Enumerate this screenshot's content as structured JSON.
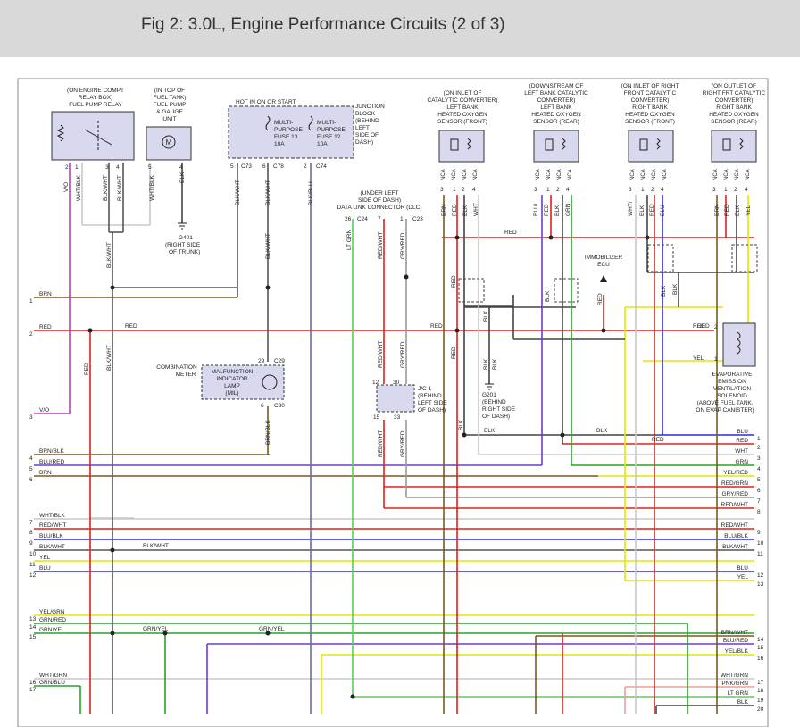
{
  "header": {
    "title": "Fig 2: 3.0L, Engine Performance Circuits (2 of 3)"
  },
  "components": {
    "fuel_pump_relay": {
      "lines": [
        "(ON ENGINE COMPT",
        "RELAY BOX)",
        "FUEL PUMP RELAY"
      ],
      "pins": [
        "2",
        "1",
        "3",
        "4"
      ],
      "wires": [
        "V/O",
        "WHT/BLK",
        "BLK/WHT",
        "BLK/WHT"
      ]
    },
    "fuel_pump": {
      "lines": [
        "(IN TOP OF",
        "FUEL TANK)",
        "FUEL PUMP",
        "& GAUGE",
        "UNIT"
      ],
      "pins": [
        "5",
        "4"
      ],
      "wires": [
        "WHT/BLK",
        "BLK"
      ],
      "motor": "M"
    },
    "ground_g401": {
      "lines": [
        "G401",
        "(RIGHT SIDE",
        "OF TRUNK)"
      ]
    },
    "hot_label": "HOT IN ON OR START",
    "junction_block": {
      "lines": [
        "JUNCTION",
        "BLOCK",
        "(BEHIND",
        "LEFT",
        "SIDE OF",
        "DASH)"
      ]
    },
    "fuse13": {
      "lines": [
        "MULTI-",
        "PURPOSE",
        "FUSE 13",
        "10A"
      ]
    },
    "fuse12": {
      "lines": [
        "MULTI-",
        "PURPOSE",
        "FUSE 12",
        "10A"
      ]
    },
    "fuse_pins": [
      "5",
      "C73",
      "6",
      "C78",
      "2",
      "C74"
    ],
    "fuse_wires": [
      "BLK/WHT",
      "BLK/WHT",
      "BLK/BLU"
    ],
    "dlc": {
      "lines": [
        "(UNDER LEFT",
        "SIDE OF DASH)",
        "DATA LINK CONNECTOR (DLC)"
      ],
      "pins": [
        "26",
        "C24",
        "7",
        "1",
        "C23"
      ],
      "wires": [
        "LT GRN",
        "RED/WHT",
        "GRY/RED"
      ]
    },
    "o2_lf": {
      "lines": [
        "(ON INLET OF",
        "CATALYTIC CONVERTER)",
        "LEFT BANK",
        "HEATED OXYGEN",
        "SENSOR (FRONT)"
      ],
      "pins": [
        "3",
        "1",
        "2",
        "4"
      ],
      "wires": [
        "BRN",
        "RED",
        "BLK",
        "WHT"
      ]
    },
    "o2_lr": {
      "lines": [
        "(DOWNSTREAM OF",
        "LEFT BANK CATALYTIC",
        "CONVERTER)",
        "LEFT BANK",
        "HEATED OXYGEN",
        "SENSOR (REAR)"
      ],
      "pins": [
        "3",
        "1",
        "2",
        "4"
      ],
      "wires": [
        "BLU/",
        "RED",
        "BLK",
        "GRN"
      ]
    },
    "o2_rf": {
      "lines": [
        "(ON INLET OF RIGHT",
        "FRONT CATALYTIC",
        "CONVERTER)",
        "RIGHT BANK",
        "HEATED OXYGEN",
        "SENSOR (FRONT)"
      ],
      "pins": [
        "3",
        "1",
        "2",
        "4"
      ],
      "wires": [
        "WHT/",
        "BLK",
        "RED",
        "BLU"
      ]
    },
    "o2_rr": {
      "lines": [
        "(ON OUTLET OF",
        "RIGHT FRT CATALYTIC",
        "CONVERTER)",
        "RIGHT BANK",
        "HEATED OXYGEN",
        "SENSOR (REAR)"
      ],
      "pins": [
        "3",
        "1",
        "2",
        "4"
      ],
      "wires": [
        "BRN",
        "RED",
        "BLK",
        "YEL"
      ]
    },
    "nca": "NCA",
    "immobilizer": {
      "lines": [
        "IMMOBILIZER",
        "ECU"
      ],
      "wire": "RED"
    },
    "mil": {
      "left_lines": [
        "COMBINATION",
        "METER"
      ],
      "lines": [
        "MALFUNCTION",
        "INDICATOR",
        "LAMP",
        "(MIL)"
      ],
      "pins": [
        "29",
        "C29",
        "6",
        "C30"
      ],
      "wire": "BRN/BLK"
    },
    "jc1": {
      "lines": [
        "J/C 1",
        "(BEHIND",
        "LEFT SIDE",
        "OF DASH)"
      ],
      "pins": [
        "12",
        "30",
        "15",
        "33"
      ],
      "wires": [
        "RED/WHT",
        "GRY/RED",
        "RED/WHT",
        "GRY/RED"
      ]
    },
    "g201": {
      "lines": [
        "G201",
        "(BEHIND",
        "RIGHT SIDE",
        "OF DASH)"
      ],
      "wire": "BLK"
    },
    "evap": {
      "lines": [
        "EVAPORATIVE",
        "EMISSION",
        "VENTILATION",
        "SOLENOID",
        "(ABOVE FUEL TANK,",
        "ON EVAP CANISTER)"
      ],
      "pins": [
        "2",
        "1"
      ],
      "wires": [
        "RED",
        "YEL"
      ]
    }
  },
  "left_wires": [
    {
      "num": "1",
      "label": "BRN"
    },
    {
      "num": "2",
      "label": "RED"
    },
    {
      "num": "3",
      "label": "V/O"
    },
    {
      "num": "4",
      "label": "BRN/BLK"
    },
    {
      "num": "5",
      "label": "BLU/RED"
    },
    {
      "num": "6",
      "label": "BRN"
    },
    {
      "num": "7",
      "label": "WHT/BLK"
    },
    {
      "num": "8",
      "label": "RED/WHT"
    },
    {
      "num": "9",
      "label": "BLU/BLK"
    },
    {
      "num": "10",
      "label": "BLK/WHT"
    },
    {
      "num": "11",
      "label": "YEL"
    },
    {
      "num": "12",
      "label": "BLU"
    },
    {
      "num": "13",
      "label": "YEL/GRN"
    },
    {
      "num": "14",
      "label": "GRN/RED"
    },
    {
      "num": "15",
      "label": "GRN/YEL"
    },
    {
      "num": "16",
      "label": "WHT/GRN"
    },
    {
      "num": "17",
      "label": "GRN/BLU"
    }
  ],
  "right_wires": [
    {
      "num": "1",
      "label": "BLU"
    },
    {
      "num": "2",
      "label": "RED"
    },
    {
      "num": "3",
      "label": "WHT"
    },
    {
      "num": "4",
      "label": "GRN"
    },
    {
      "num": "5",
      "label": "YEL/RED"
    },
    {
      "num": "6",
      "label": "RED/GRN"
    },
    {
      "num": "7",
      "label": "GRY/RED"
    },
    {
      "num": "8",
      "label": "RED/WHT"
    },
    {
      "num": "9",
      "label": "RED/WHT"
    },
    {
      "num": "10",
      "label": "BLU/BLK"
    },
    {
      "num": "11",
      "label": "BLK/WHT"
    },
    {
      "num": "12",
      "label": "BLU"
    },
    {
      "num": "13",
      "label": "YEL"
    },
    {
      "num": "14",
      "label": "BRN/WHT"
    },
    {
      "num": "15",
      "label": "BLU/RED"
    },
    {
      "num": "16",
      "label": "YEL/BLK"
    },
    {
      "num": "17",
      "label": "WHT/GRN"
    },
    {
      "num": "18",
      "label": "PNK/GRN"
    },
    {
      "num": "19",
      "label": "LT GRN"
    },
    {
      "num": "20",
      "label": "BLK"
    }
  ],
  "mid_labels": {
    "red_row2": "RED",
    "red_right": "RED",
    "blk_row": "BLK",
    "blk_row2": "BLK",
    "red_row": "RED",
    "blk_wht_row10": "BLK/WHT",
    "grn_yel_a": "GRN/YEL",
    "grn_yel_b": "GRN/YEL",
    "red_o2": "RED",
    "blk_o2a": "BLK",
    "blk_o2b": "BLK",
    "red_v": "RED",
    "red_v2": "RED",
    "blk_v": "BLK",
    "blk_v2": "BLK",
    "blk_wht_v": "BLK/WHT",
    "blk_wht_v2": "BLK/WHT",
    "red_left_v": "RED",
    "red_wht_v": "RED/WHT",
    "gry_red_v": "GRY/RED",
    "blk_v3": "BLK",
    "brn_blk_v": "BRN/BLK",
    "red_dot": "RED",
    "blk_dot": "BLK"
  },
  "colors": {
    "brn": "#7a5a1e",
    "red": "#e0201c",
    "vo": "#cc33cc",
    "blu": "#2a2ae0",
    "blured": "#6a3ad8",
    "wht": "#c8c8c8",
    "ylw": "#e6e600",
    "grn": "#2aa02a",
    "ltgrn": "#55d055",
    "blk": "#444444",
    "gry": "#9a9a9a",
    "comp": "#d8d8ee"
  }
}
